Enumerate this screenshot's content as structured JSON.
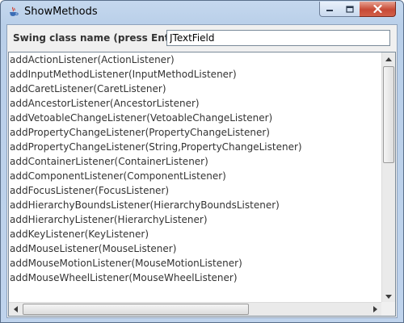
{
  "window": {
    "title": "ShowMethods",
    "icon": "java-cup-icon"
  },
  "form": {
    "label": "Swing class name (press Enter):",
    "input_value": "JTextField"
  },
  "methods": [
    "addActionListener(ActionListener)",
    "addInputMethodListener(InputMethodListener)",
    "addCaretListener(CaretListener)",
    "addAncestorListener(AncestorListener)",
    "addVetoableChangeListener(VetoableChangeListener)",
    "addPropertyChangeListener(PropertyChangeListener)",
    "addPropertyChangeListener(String,PropertyChangeListener)",
    "addContainerListener(ContainerListener)",
    "addComponentListener(ComponentListener)",
    "addFocusListener(FocusListener)",
    "addHierarchyBoundsListener(HierarchyBoundsListener)",
    "addHierarchyListener(HierarchyListener)",
    "addKeyListener(KeyListener)",
    "addMouseListener(MouseListener)",
    "addMouseMotionListener(MouseMotionListener)",
    "addMouseWheelListener(MouseWheelListener)"
  ],
  "colors": {
    "title_bar": "#b9cfe9",
    "close_button": "#c74a36"
  }
}
